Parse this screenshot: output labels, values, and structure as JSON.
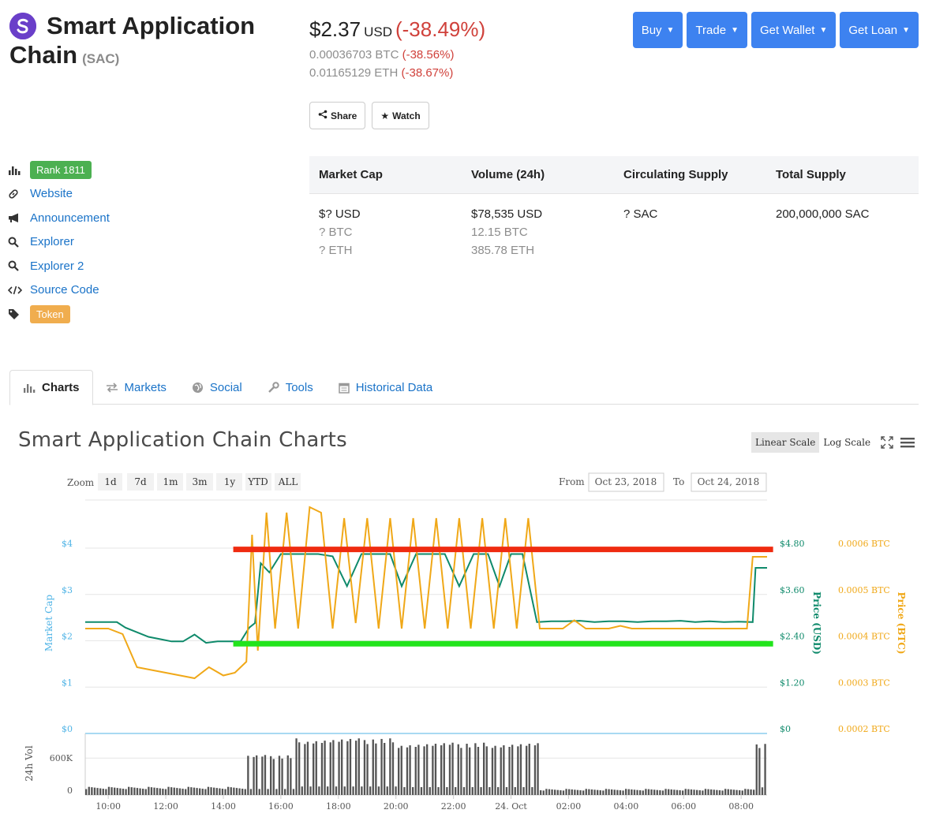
{
  "coin": {
    "name_line1": "Smart Application",
    "name_line2": "Chain",
    "symbol": "(SAC)"
  },
  "price": {
    "usd": "$2.37",
    "usd_label": "USD",
    "usd_change": "(-38.49%)",
    "btc": "0.00036703 BTC",
    "btc_change": "(-38.56%)",
    "eth": "0.01165129 ETH",
    "eth_change": "(-38.67%)"
  },
  "header_buttons": {
    "buy": "Buy",
    "trade": "Trade",
    "wallet": "Get Wallet",
    "loan": "Get Loan"
  },
  "actions": {
    "share": "Share",
    "watch": "Watch"
  },
  "links": {
    "rank": "Rank 1811",
    "website": "Website",
    "announcement": "Announcement",
    "explorer": "Explorer",
    "explorer2": "Explorer 2",
    "source": "Source Code",
    "token": "Token"
  },
  "stats": {
    "headers": [
      "Market Cap",
      "Volume (24h)",
      "Circulating Supply",
      "Total Supply"
    ],
    "market_cap": [
      "$? USD",
      "? BTC",
      "? ETH"
    ],
    "volume": [
      "$78,535 USD",
      "12.15 BTC",
      "385.78 ETH"
    ],
    "circulating": [
      "? SAC"
    ],
    "total": [
      "200,000,000 SAC"
    ]
  },
  "tabs": [
    "Charts",
    "Markets",
    "Social",
    "Tools",
    "Historical Data"
  ],
  "chart_header": {
    "title": "Smart Application Chain Charts",
    "linear": "Linear Scale",
    "log": "Log Scale"
  },
  "range_selector": {
    "zoom_label": "Zoom",
    "buttons": [
      "1d",
      "7d",
      "1m",
      "3m",
      "1y",
      "YTD",
      "ALL"
    ],
    "from_label": "From",
    "from": "Oct 23, 2018",
    "to_label": "To",
    "to": "Oct 24, 2018"
  },
  "colors": {
    "usd_line": "#0f8a6b",
    "btc_line": "#f0a818",
    "market_cap_axis": "#50b4e6",
    "volume_bars": "#555555",
    "red_annotation": "#ef2b10",
    "green_annotation": "#22e41c",
    "accent": "#3d82f0"
  },
  "chart_data": {
    "type": "line",
    "x_axis": {
      "tick_labels": [
        "10:00",
        "12:00",
        "14:00",
        "16:00",
        "18:00",
        "20:00",
        "22:00",
        "24. Oct",
        "02:00",
        "04:00",
        "06:00",
        "08:00"
      ],
      "range": [
        9.2,
        32.9
      ]
    },
    "y_left": {
      "label": "Market Cap",
      "ticks": [
        "$4",
        "$3",
        "$2",
        "$1",
        "$0"
      ],
      "range": [
        0,
        4
      ]
    },
    "y_right_usd": {
      "label": "Price (USD)",
      "ticks": [
        "$4.80",
        "$3.60",
        "$2.40",
        "$1.20",
        "$0"
      ],
      "range": [
        0,
        4.8
      ]
    },
    "y_right_btc": {
      "label": "Price (BTC)",
      "ticks": [
        "0.0006 BTC",
        "0.0005 BTC",
        "0.0004 BTC",
        "0.0003 BTC",
        "0.0002 BTC"
      ],
      "range": [
        0.0002,
        0.0006
      ]
    },
    "volume_axis": {
      "label": "24h Vol",
      "ticks": [
        "600K",
        "0"
      ],
      "range": [
        0,
        1000000
      ]
    },
    "series": [
      {
        "name": "Price (USD)",
        "x": [
          9.2,
          10.3,
          10.6,
          11.0,
          11.4,
          11.8,
          12.2,
          12.6,
          13.0,
          13.4,
          13.8,
          14.2,
          14.6,
          14.9,
          15.1,
          15.3,
          15.6,
          16.0,
          16.4,
          16.8,
          17.3,
          17.8,
          18.3,
          18.8,
          19.3,
          19.8,
          20.2,
          20.7,
          21.2,
          21.7,
          22.2,
          22.7,
          23.2,
          23.6,
          24.0,
          24.4,
          24.9,
          25.4,
          25.9,
          26.4,
          26.9,
          27.4,
          27.9,
          28.4,
          28.9,
          29.4,
          29.9,
          30.4,
          30.9,
          31.4,
          31.9,
          32.4,
          32.5,
          32.9
        ],
        "values": [
          2.42,
          2.42,
          2.3,
          2.2,
          2.1,
          2.05,
          2.0,
          2.0,
          2.15,
          1.97,
          2.0,
          2.0,
          2.0,
          2.3,
          2.4,
          3.7,
          3.5,
          3.9,
          3.9,
          3.9,
          3.9,
          3.85,
          3.2,
          3.9,
          3.9,
          3.9,
          3.2,
          3.9,
          3.9,
          3.9,
          3.2,
          3.9,
          3.9,
          3.2,
          3.9,
          3.9,
          2.42,
          2.44,
          2.44,
          2.45,
          2.42,
          2.44,
          2.44,
          2.42,
          2.44,
          2.44,
          2.45,
          2.42,
          2.44,
          2.42,
          2.43,
          2.42,
          3.6,
          3.6
        ]
      },
      {
        "name": "Price (BTC)",
        "x": [
          9.2,
          10.0,
          10.5,
          11.0,
          11.5,
          12.0,
          12.5,
          13.0,
          13.5,
          14.0,
          14.4,
          14.8,
          15.0,
          15.2,
          15.5,
          15.8,
          16.2,
          16.6,
          17.0,
          17.4,
          17.8,
          18.2,
          18.6,
          19.0,
          19.4,
          19.8,
          20.2,
          20.6,
          21.0,
          21.4,
          21.8,
          22.2,
          22.6,
          23.0,
          23.4,
          23.8,
          24.2,
          24.6,
          25.0,
          25.4,
          25.8,
          26.2,
          26.6,
          27.0,
          27.4,
          27.8,
          28.2,
          28.6,
          29.0,
          29.4,
          29.8,
          30.2,
          30.6,
          31.0,
          31.4,
          31.8,
          32.2,
          32.4,
          32.9
        ],
        "values": [
          0.00039,
          0.00039,
          0.00038,
          0.00032,
          0.000315,
          0.00031,
          0.000305,
          0.0003,
          0.00032,
          0.000305,
          0.00031,
          0.00033,
          0.00056,
          0.00035,
          0.0006,
          0.00039,
          0.0006,
          0.00039,
          0.00061,
          0.0006,
          0.00039,
          0.00059,
          0.0004,
          0.00059,
          0.00039,
          0.00059,
          0.00039,
          0.00059,
          0.00039,
          0.00059,
          0.00039,
          0.00059,
          0.00039,
          0.00059,
          0.00039,
          0.00059,
          0.00039,
          0.00059,
          0.00039,
          0.00039,
          0.00039,
          0.000405,
          0.00039,
          0.00039,
          0.00039,
          0.000395,
          0.00039,
          0.00039,
          0.00039,
          0.00039,
          0.00039,
          0.00039,
          0.00039,
          0.00039,
          0.00039,
          0.00039,
          0.00039,
          0.00052,
          0.00052
        ]
      }
    ],
    "annotations": [
      {
        "type": "horizontal-line",
        "color": "red",
        "usd_value": 4.0,
        "x_start": 14.4,
        "x_end": 33.0
      },
      {
        "type": "horizontal-line",
        "color": "green",
        "usd_value": 1.95,
        "x_start": 14.4,
        "x_end": 33.0
      }
    ],
    "volume": {
      "x_start": 9.2,
      "x_end": 32.9,
      "bars": 240,
      "levels": [
        {
          "from": 9.2,
          "to": 14.8,
          "value": 120000
        },
        {
          "from": 14.8,
          "to": 16.5,
          "value": 650000
        },
        {
          "from": 16.5,
          "to": 20.0,
          "value": 920000
        },
        {
          "from": 20.0,
          "to": 25.0,
          "value": 850000
        },
        {
          "from": 25.0,
          "to": 32.5,
          "value": 90000
        },
        {
          "from": 32.5,
          "to": 32.9,
          "value": 830000
        }
      ]
    },
    "grid": true
  }
}
